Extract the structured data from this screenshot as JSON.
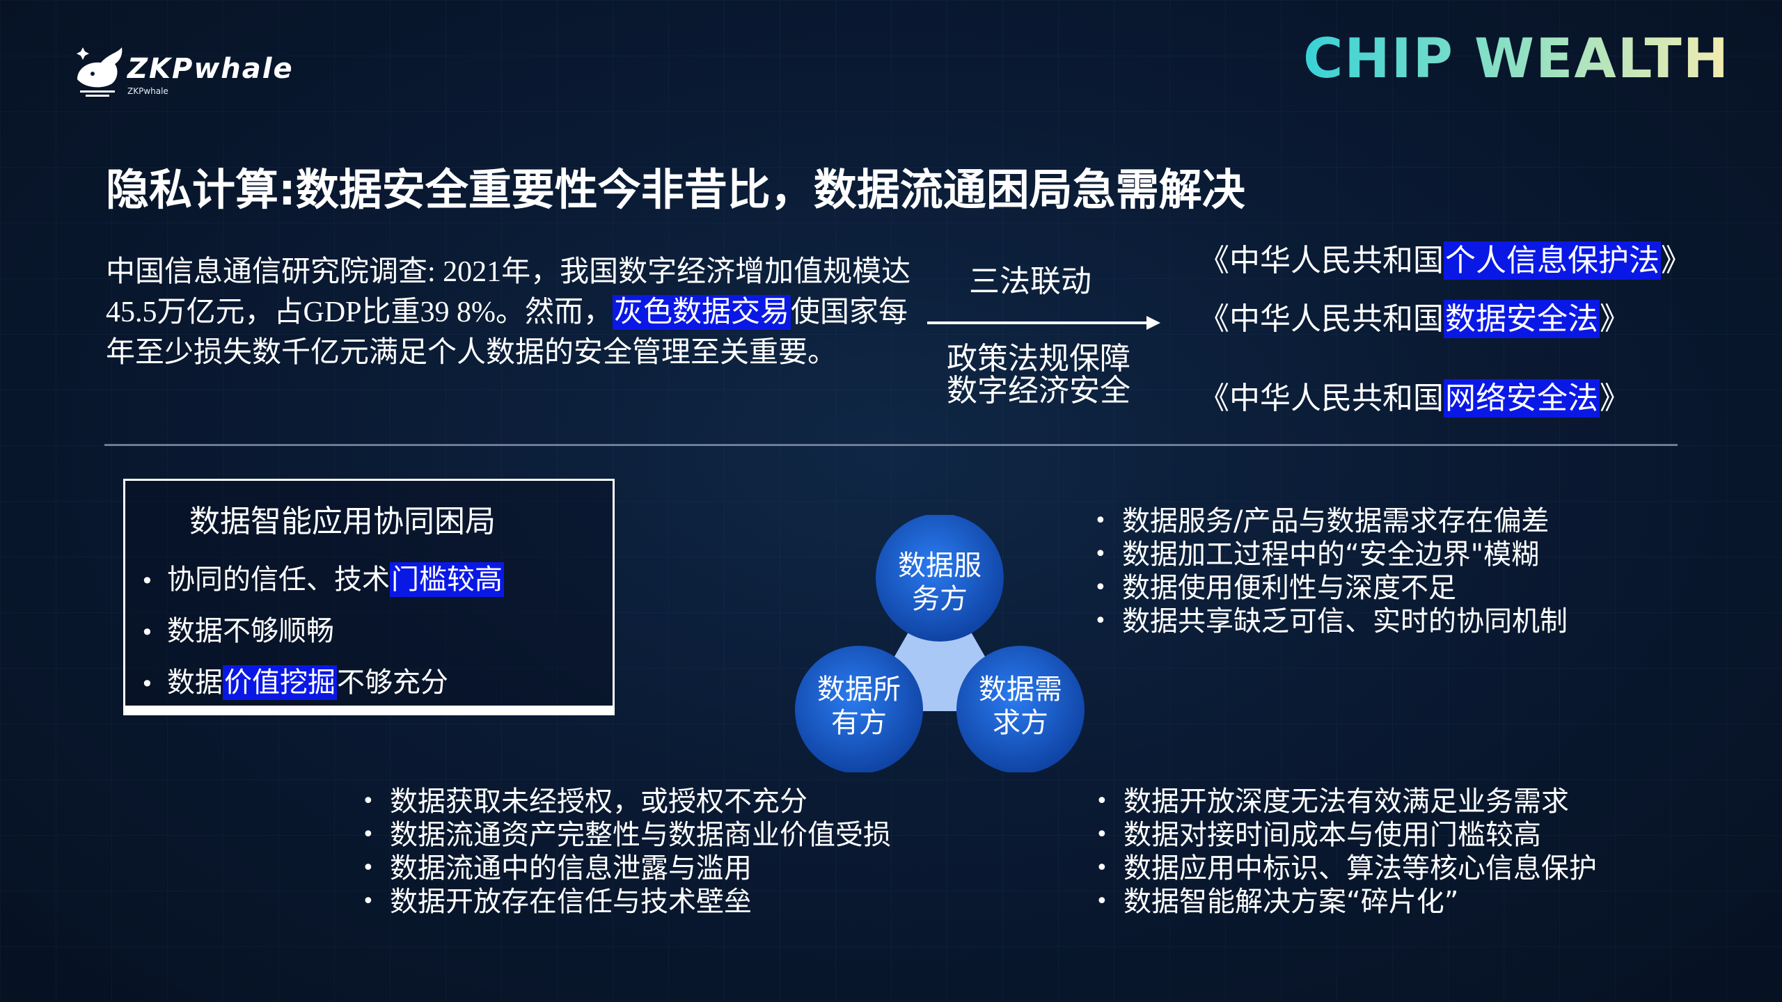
{
  "logo": {
    "name": "ZKPwhale",
    "sub": "ZKPwhale",
    "icon": "whale-icon"
  },
  "brand": "CHIP WEALTH",
  "title": "隐私计算:数据安全重要性今非昔比，数据流通困局急需解决",
  "intro": {
    "part1": "中国信息通信研究院调查: 2021年，我国数字经济增加值规模达45.5万亿元，占GDP比重39 8%。然而，",
    "highlight": "灰色数据交易",
    "part2": "使国家每年至少损失数千亿元满足个人数据的安全管理至关重要。"
  },
  "center": {
    "top_label": "三法联动",
    "policy_line1": "政策法规保障",
    "policy_line2": "数字经济安全"
  },
  "laws": [
    {
      "prefix": "《中华人民共和国",
      "highlight": "个人信息保护法",
      "suffix": "》"
    },
    {
      "prefix": "《中华人民共和国",
      "highlight": "数据安全法",
      "suffix": "》"
    },
    {
      "prefix": "《中华人民共和国",
      "highlight": "网络安全法",
      "suffix": "》"
    }
  ],
  "box": {
    "title": "数据智能应用协同困局",
    "items": [
      {
        "pre": "协同的信任、技术",
        "hl": "门槛较高",
        "post": ""
      },
      {
        "pre": "数据不够顺畅",
        "hl": "",
        "post": ""
      },
      {
        "pre": "数据",
        "hl": "价值挖掘",
        "post": "不够充分"
      }
    ]
  },
  "diagram": {
    "top": [
      "数据服",
      "务方"
    ],
    "left": [
      "数据所",
      "有方"
    ],
    "right": [
      "数据需",
      "求方"
    ],
    "colors": {
      "circle": "#1560d8",
      "circle_dark": "#0d3f9e",
      "center": "#a9c8f5"
    }
  },
  "service_points": [
    "数据服务/产品与数据需求存在偏差",
    "数据加工过程中的“安全边界\"模糊",
    "数据使用便利性与深度不足",
    "数据共享缺乏可信、实时的协同机制"
  ],
  "owner_points": [
    "数据获取未经授权，或授权不充分",
    "数据流通资产完整性与数据商业价值受损",
    "数据流通中的信息泄露与滥用",
    "数据开放存在信任与技术壁垒"
  ],
  "demand_points": [
    "数据开放深度无法有效满足业务需求",
    "数据对接时间成本与使用门槛较高",
    "数据应用中标识、算法等核心信息保护",
    "数据智能解决方案“碎片化”"
  ]
}
